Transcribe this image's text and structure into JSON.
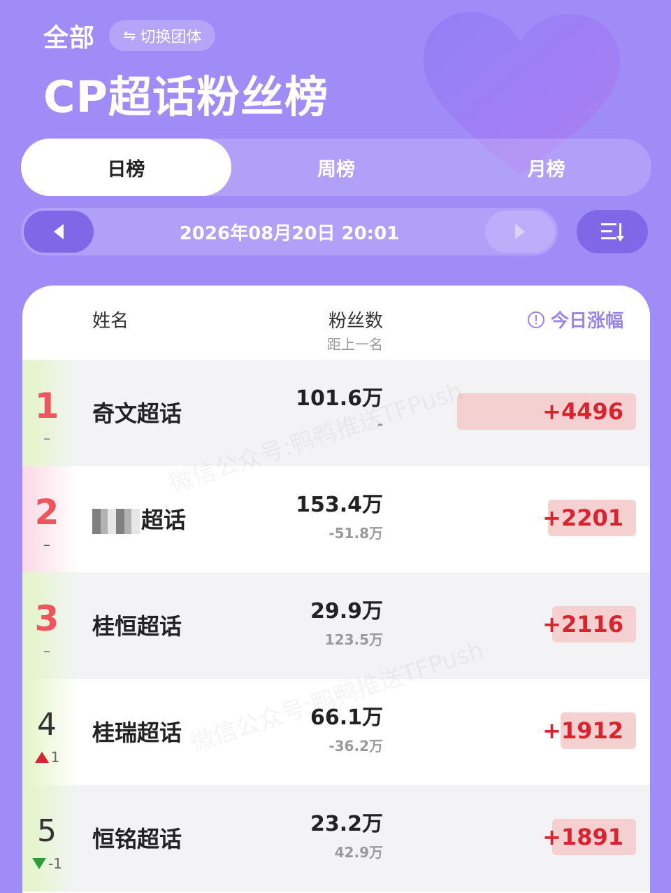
{
  "header": {
    "scope_label": "全部",
    "switch_label": "切换团体",
    "title": "CP超话粉丝榜"
  },
  "tabs": [
    {
      "label": "日榜",
      "active": true
    },
    {
      "label": "周榜",
      "active": false
    },
    {
      "label": "月榜",
      "active": false
    }
  ],
  "date_bar": {
    "datetime": "2026年08月20日 20:01"
  },
  "table": {
    "col_name": "姓名",
    "col_fans": "粉丝数",
    "col_fans_sub": "距上一名",
    "col_growth": "今日涨幅",
    "rows": [
      {
        "rank": "1",
        "change": "–",
        "name": "奇文超话",
        "fans": "101.6万",
        "gap": "-",
        "growth": "+4496"
      },
      {
        "rank": "2",
        "change": "–",
        "name": "超话",
        "fans": "153.4万",
        "gap": "-51.8万",
        "growth": "+2201"
      },
      {
        "rank": "3",
        "change": "–",
        "name": "桂恒超话",
        "fans": "29.9万",
        "gap": "123.5万",
        "growth": "+2116"
      },
      {
        "rank": "4",
        "change": "1",
        "name": "桂瑞超话",
        "fans": "66.1万",
        "gap": "-36.2万",
        "growth": "+1912"
      },
      {
        "rank": "5",
        "change": "-1",
        "name": "恒铭超话",
        "fans": "23.2万",
        "gap": "42.9万",
        "growth": "+1891"
      }
    ]
  },
  "watermark": "微信公众号:鸭鸭推送TFPush",
  "colors": {
    "background": "#a08cf6",
    "accent": "#8067e8",
    "growth_text": "#d9232f",
    "growth_bg": "#f4d0d0",
    "rank_top": "#f0545e",
    "up": "#d9232f",
    "down": "#2e9e3a"
  }
}
